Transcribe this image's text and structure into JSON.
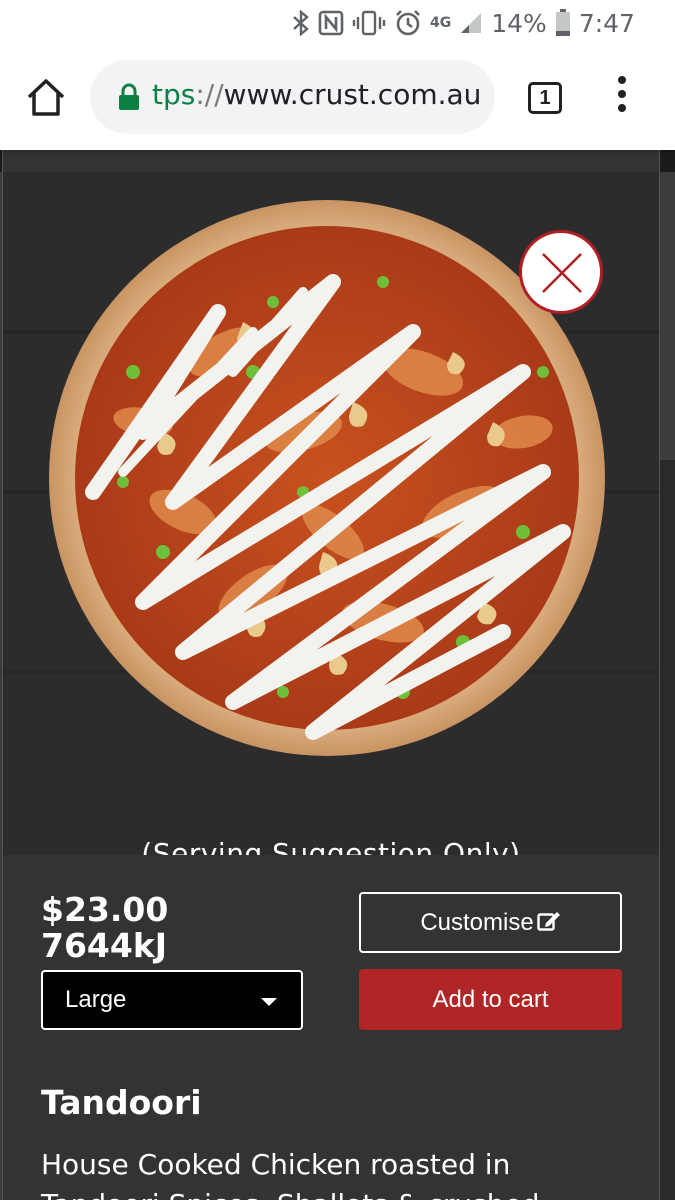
{
  "status_bar": {
    "battery": "14%",
    "time": "7:47",
    "network": "4G",
    "icons": [
      "bluetooth-icon",
      "nfc-icon",
      "vibrate-icon",
      "alarm-icon",
      "signal-icon",
      "battery-icon"
    ]
  },
  "browser": {
    "url_scheme": "tps",
    "url_sep": "://",
    "url_host": "www.crust.com.au",
    "tab_count": "1",
    "lock_color": "#0b8043"
  },
  "product": {
    "serving_note": "(Serving Suggestion Only)",
    "price": "$23.00",
    "energy": "7644kJ",
    "size_selected": "Large",
    "customise_label": "Customise",
    "add_to_cart_label": "Add to cart",
    "name": "Tandoori",
    "description": "House Cooked Chicken roasted in Tandoori Spices, Shallots & crushed"
  },
  "colors": {
    "accent_red": "#b02525",
    "close_red": "#b11e24",
    "panel_bg": "#333333"
  }
}
